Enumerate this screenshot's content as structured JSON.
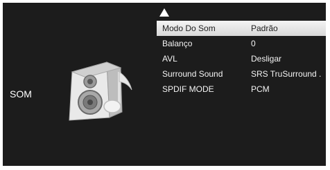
{
  "section": {
    "title": "SOM",
    "icon": "speaker-music-note-icon"
  },
  "menu": {
    "items": [
      {
        "label": "Modo Do Som",
        "value": "Padrão",
        "selected": true
      },
      {
        "label": "Balanço",
        "value": "0",
        "selected": false
      },
      {
        "label": "AVL",
        "value": "Desligar",
        "selected": false
      },
      {
        "label": "Surround Sound",
        "value": "SRS TruSurround .",
        "selected": false
      },
      {
        "label": "SPDIF MODE",
        "value": "PCM",
        "selected": false
      }
    ]
  },
  "colors": {
    "background": "#1c1c1c",
    "highlight": "#e8e8e8",
    "text": "#f4f4f4"
  }
}
